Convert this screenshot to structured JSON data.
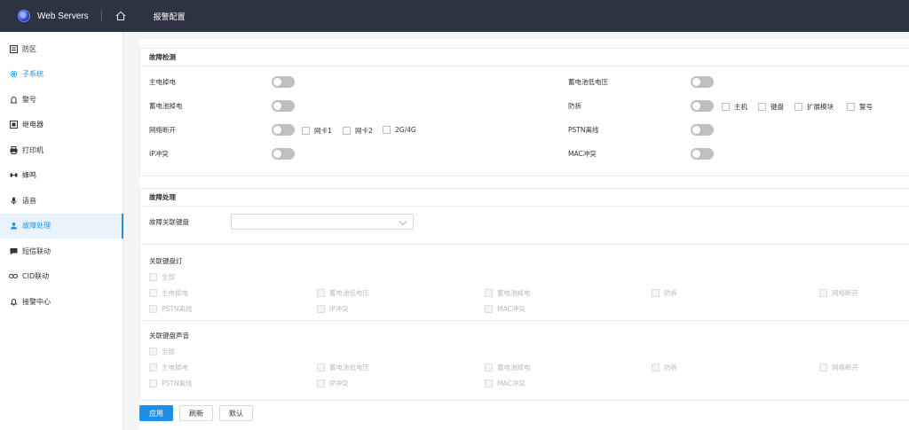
{
  "header": {
    "app_title": "Web Servers",
    "crumb": "报警配置",
    "logo_icon": "globe-logo-icon",
    "home_icon": "home-icon"
  },
  "sidebar": {
    "items": [
      {
        "label": "防区",
        "icon": "zone-icon"
      },
      {
        "label": "子系统",
        "icon": "gear-icon"
      },
      {
        "label": "警号",
        "icon": "siren-icon"
      },
      {
        "label": "继电器",
        "icon": "relay-icon"
      },
      {
        "label": "打印机",
        "icon": "printer-icon"
      },
      {
        "label": "蜂鸣",
        "icon": "buzzer-icon"
      },
      {
        "label": "语音",
        "icon": "mic-icon"
      },
      {
        "label": "故障处理",
        "icon": "fault-icon"
      },
      {
        "label": "短信联动",
        "icon": "sms-icon"
      },
      {
        "label": "CID联动",
        "icon": "link-icon"
      },
      {
        "label": "接警中心",
        "icon": "bell-icon"
      }
    ],
    "active_index": 7,
    "accent": "#1f8ee8"
  },
  "fault_detect": {
    "title": "故障检测",
    "main_power": "主电掉电",
    "battery_power": "蓄电池掉电",
    "network": "网络断开",
    "network_options": [
      "网卡1",
      "网卡2",
      "2G/4G"
    ],
    "ip_conflict": "IP冲突",
    "battery_low": "蓄电池低电压",
    "tamper": "防拆",
    "tamper_options": [
      "主机",
      "键盘",
      "扩展模块",
      "警号"
    ],
    "pstn": "PSTN离线",
    "mac_conflict": "MAC冲突"
  },
  "fault_handle": {
    "title": "故障处理",
    "keyboard_label": "故障关联键盘",
    "keyboard_value": "",
    "light_title": "关联键盘灯",
    "sound_title": "关联键盘声音",
    "all_label": "全部",
    "options": [
      "主电掉电",
      "蓄电池低电压",
      "蓄电池掉电",
      "防拆",
      "网络断开",
      "PSTN离线",
      "IP冲突",
      "MAC冲突"
    ]
  },
  "buttons": {
    "apply": "应用",
    "refresh": "刷新",
    "default": "默认"
  }
}
